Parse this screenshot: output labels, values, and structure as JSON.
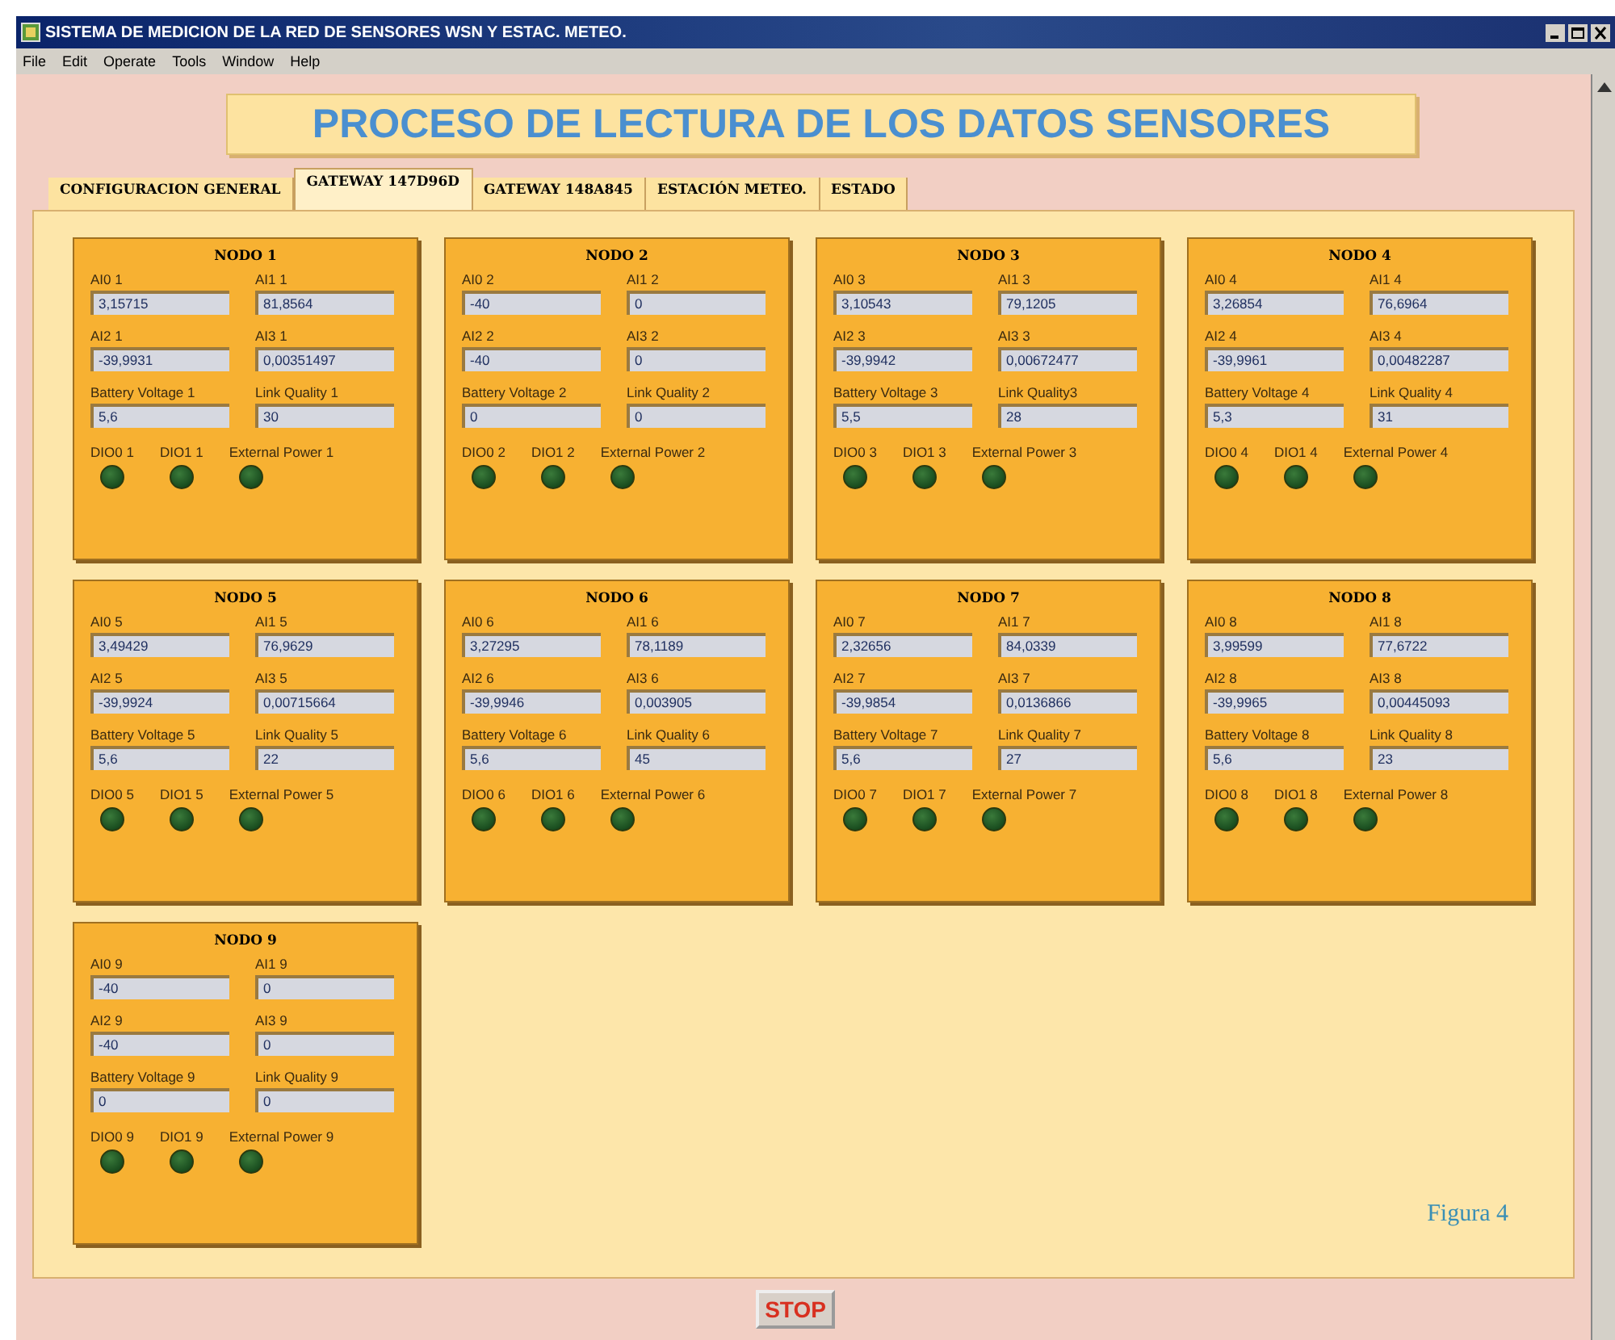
{
  "window": {
    "title": "SISTEMA DE MEDICION DE LA RED DE SENSORES WSN Y ESTAC. METEO."
  },
  "menu": [
    "File",
    "Edit",
    "Operate",
    "Tools",
    "Window",
    "Help"
  ],
  "banner": "PROCESO DE LECTURA DE LOS DATOS SENSORES",
  "tabs": [
    {
      "label": "CONFIGURACION GENERAL",
      "selected": false
    },
    {
      "label": "GATEWAY 147D96D",
      "selected": true
    },
    {
      "label": "GATEWAY 148A845",
      "selected": false
    },
    {
      "label": "ESTACIÓN METEO.",
      "selected": false
    },
    {
      "label": "ESTADO",
      "selected": false
    }
  ],
  "nodes": [
    {
      "title": "NODO 1",
      "fields": [
        {
          "label": "AI0 1",
          "value": "3,15715"
        },
        {
          "label": "AI1 1",
          "value": "81,8564"
        },
        {
          "label": "AI2 1",
          "value": "-39,9931"
        },
        {
          "label": "AI3 1",
          "value": "0,00351497"
        },
        {
          "label": "Battery Voltage 1",
          "value": "5,6"
        },
        {
          "label": "Link Quality 1",
          "value": "30"
        }
      ],
      "leds": [
        {
          "label": "DIO0 1",
          "on": false
        },
        {
          "label": "DIO1 1",
          "on": false
        },
        {
          "label": "External Power 1",
          "on": false
        }
      ]
    },
    {
      "title": "NODO 2",
      "fields": [
        {
          "label": "AI0 2",
          "value": "-40"
        },
        {
          "label": "AI1 2",
          "value": "0"
        },
        {
          "label": "AI2 2",
          "value": "-40"
        },
        {
          "label": "AI3 2",
          "value": "0"
        },
        {
          "label": "Battery Voltage 2",
          "value": "0"
        },
        {
          "label": "Link Quality 2",
          "value": "0"
        }
      ],
      "leds": [
        {
          "label": "DIO0 2",
          "on": false
        },
        {
          "label": "DIO1 2",
          "on": false
        },
        {
          "label": "External Power 2",
          "on": false
        }
      ]
    },
    {
      "title": "NODO 3",
      "fields": [
        {
          "label": "AI0 3",
          "value": "3,10543"
        },
        {
          "label": "AI1 3",
          "value": "79,1205"
        },
        {
          "label": "AI2 3",
          "value": "-39,9942"
        },
        {
          "label": "AI3 3",
          "value": "0,00672477"
        },
        {
          "label": "Battery Voltage 3",
          "value": "5,5"
        },
        {
          "label": "Link Quality3",
          "value": "28"
        }
      ],
      "leds": [
        {
          "label": "DIO0 3",
          "on": false
        },
        {
          "label": "DIO1 3",
          "on": false
        },
        {
          "label": "External Power 3",
          "on": false
        }
      ]
    },
    {
      "title": "NODO 4",
      "fields": [
        {
          "label": "AI0 4",
          "value": "3,26854"
        },
        {
          "label": "AI1 4",
          "value": "76,6964"
        },
        {
          "label": "AI2 4",
          "value": "-39,9961"
        },
        {
          "label": "AI3 4",
          "value": "0,00482287"
        },
        {
          "label": "Battery Voltage 4",
          "value": "5,3"
        },
        {
          "label": "Link Quality 4",
          "value": "31"
        }
      ],
      "leds": [
        {
          "label": "DIO0 4",
          "on": false
        },
        {
          "label": "DIO1 4",
          "on": false
        },
        {
          "label": "External Power 4",
          "on": false
        }
      ]
    },
    {
      "title": "NODO 5",
      "fields": [
        {
          "label": "AI0 5",
          "value": "3,49429"
        },
        {
          "label": "AI1 5",
          "value": "76,9629"
        },
        {
          "label": "AI2 5",
          "value": "-39,9924"
        },
        {
          "label": "AI3 5",
          "value": "0,00715664"
        },
        {
          "label": "Battery Voltage 5",
          "value": "5,6"
        },
        {
          "label": "Link Quality 5",
          "value": "22"
        }
      ],
      "leds": [
        {
          "label": "DIO0 5",
          "on": false
        },
        {
          "label": "DIO1 5",
          "on": false
        },
        {
          "label": "External Power 5",
          "on": false
        }
      ]
    },
    {
      "title": "NODO 6",
      "fields": [
        {
          "label": "AI0 6",
          "value": "3,27295"
        },
        {
          "label": "AI1 6",
          "value": "78,1189"
        },
        {
          "label": "AI2 6",
          "value": "-39,9946"
        },
        {
          "label": "AI3 6",
          "value": "0,003905"
        },
        {
          "label": "Battery Voltage 6",
          "value": "5,6"
        },
        {
          "label": "Link Quality 6",
          "value": "45"
        }
      ],
      "leds": [
        {
          "label": "DIO0 6",
          "on": false
        },
        {
          "label": "DIO1 6",
          "on": false
        },
        {
          "label": "External Power 6",
          "on": false
        }
      ]
    },
    {
      "title": "NODO 7",
      "fields": [
        {
          "label": "AI0 7",
          "value": "2,32656"
        },
        {
          "label": "AI1 7",
          "value": "84,0339"
        },
        {
          "label": "AI2 7",
          "value": "-39,9854"
        },
        {
          "label": "AI3 7",
          "value": "0,0136866"
        },
        {
          "label": "Battery Voltage 7",
          "value": "5,6"
        },
        {
          "label": "Link Quality 7",
          "value": "27"
        }
      ],
      "leds": [
        {
          "label": "DIO0 7",
          "on": false
        },
        {
          "label": "DIO1 7",
          "on": false
        },
        {
          "label": "External Power 7",
          "on": false
        }
      ]
    },
    {
      "title": "NODO 8",
      "fields": [
        {
          "label": "AI0 8",
          "value": "3,99599"
        },
        {
          "label": "AI1 8",
          "value": "77,6722"
        },
        {
          "label": "AI2 8",
          "value": "-39,9965"
        },
        {
          "label": "AI3 8",
          "value": "0,00445093"
        },
        {
          "label": "Battery Voltage 8",
          "value": "5,6"
        },
        {
          "label": "Link Quality 8",
          "value": "23"
        }
      ],
      "leds": [
        {
          "label": "DIO0 8",
          "on": false
        },
        {
          "label": "DIO1 8",
          "on": false
        },
        {
          "label": "External Power 8",
          "on": false
        }
      ]
    },
    {
      "title": "NODO 9",
      "fields": [
        {
          "label": "AI0 9",
          "value": "-40"
        },
        {
          "label": "AI1 9",
          "value": "0"
        },
        {
          "label": "AI2 9",
          "value": "-40"
        },
        {
          "label": "AI3 9",
          "value": "0"
        },
        {
          "label": "Battery Voltage 9",
          "value": "0"
        },
        {
          "label": "Link Quality 9",
          "value": "0"
        }
      ],
      "leds": [
        {
          "label": "DIO0 9",
          "on": false
        },
        {
          "label": "DIO1 9",
          "on": false
        },
        {
          "label": "External Power 9",
          "on": false
        }
      ]
    }
  ],
  "caption": "Figura 4",
  "stop_button": "STOP"
}
